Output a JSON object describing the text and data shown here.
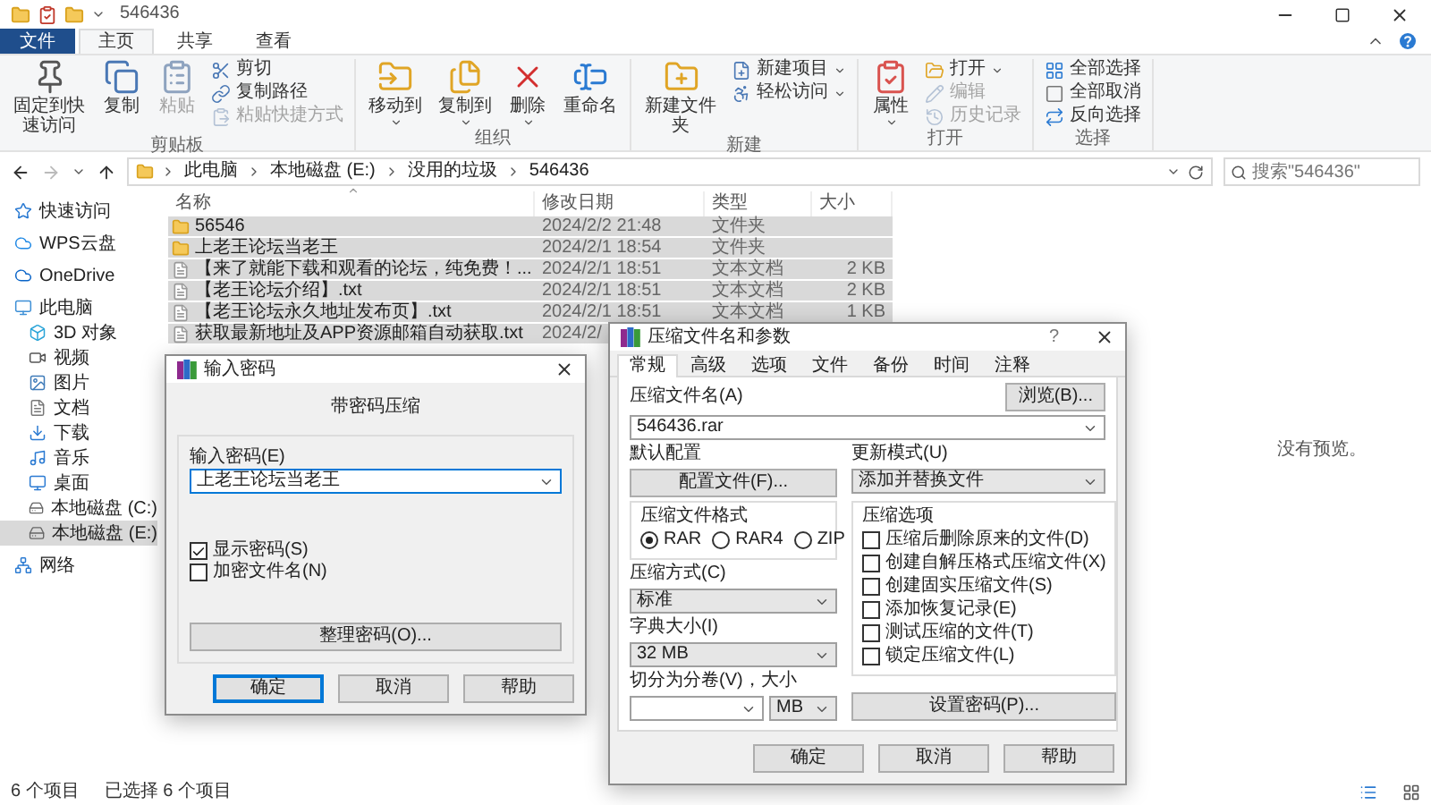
{
  "window": {
    "title": "546436"
  },
  "ribbon_tabs": [
    {
      "label": "文件",
      "kind": "file",
      "selected": false
    },
    {
      "label": "主页",
      "kind": "tab",
      "selected": true
    },
    {
      "label": "共享",
      "kind": "tab",
      "selected": false
    },
    {
      "label": "查看",
      "kind": "tab",
      "selected": false
    }
  ],
  "ribbon_groups": [
    {
      "label": "剪贴板",
      "items": [
        {
          "label": "固定到快速访问",
          "kind": "large",
          "disabled": false,
          "dropdown": false
        },
        {
          "label": "复制",
          "kind": "large",
          "disabled": false,
          "dropdown": false
        },
        {
          "label": "粘贴",
          "kind": "large",
          "disabled": true,
          "dropdown": false
        },
        {
          "label": "剪切",
          "kind": "small",
          "disabled": false,
          "dropdown": false
        },
        {
          "label": "复制路径",
          "kind": "small",
          "disabled": false,
          "dropdown": false
        },
        {
          "label": "粘贴快捷方式",
          "kind": "small",
          "disabled": true,
          "dropdown": false
        }
      ]
    },
    {
      "label": "组织",
      "items": [
        {
          "label": "移动到",
          "kind": "large",
          "disabled": false,
          "dropdown": true
        },
        {
          "label": "复制到",
          "kind": "large",
          "disabled": false,
          "dropdown": true
        },
        {
          "label": "删除",
          "kind": "large",
          "disabled": false,
          "dropdown": true
        },
        {
          "label": "重命名",
          "kind": "large",
          "disabled": false,
          "dropdown": false
        }
      ]
    },
    {
      "label": "新建",
      "items": [
        {
          "label": "新建文件夹",
          "kind": "large",
          "disabled": false,
          "dropdown": false
        },
        {
          "label": "新建项目",
          "kind": "small",
          "disabled": false,
          "dropdown": true
        },
        {
          "label": "轻松访问",
          "kind": "small",
          "disabled": false,
          "dropdown": true
        }
      ]
    },
    {
      "label": "打开",
      "items": [
        {
          "label": "属性",
          "kind": "large",
          "disabled": false,
          "dropdown": true
        },
        {
          "label": "打开",
          "kind": "small",
          "disabled": false,
          "dropdown": true
        },
        {
          "label": "编辑",
          "kind": "small",
          "disabled": true,
          "dropdown": false
        },
        {
          "label": "历史记录",
          "kind": "small",
          "disabled": true,
          "dropdown": false
        }
      ]
    },
    {
      "label": "选择",
      "items": [
        {
          "label": "全部选择",
          "kind": "small",
          "disabled": false,
          "dropdown": false
        },
        {
          "label": "全部取消",
          "kind": "small",
          "disabled": false,
          "dropdown": false
        },
        {
          "label": "反向选择",
          "kind": "small",
          "disabled": false,
          "dropdown": false
        }
      ]
    }
  ],
  "address": {
    "crumbs": [
      "此电脑",
      "本地磁盘 (E:)",
      "没用的垃圾",
      "546436"
    ]
  },
  "search": {
    "placeholder": "搜索\"546436\""
  },
  "nav": [
    {
      "label": "快速访问",
      "kind": "star",
      "selected": false
    },
    {
      "label": "WPS云盘",
      "kind": "cloud",
      "selected": false
    },
    {
      "label": "OneDrive",
      "kind": "onedrive",
      "selected": false
    },
    {
      "label": "此电脑",
      "kind": "pc",
      "selected": false,
      "children": [
        {
          "label": "3D 对象",
          "kind": "cube",
          "selected": false
        },
        {
          "label": "视频",
          "kind": "video",
          "selected": false
        },
        {
          "label": "图片",
          "kind": "image",
          "selected": false
        },
        {
          "label": "文档",
          "kind": "doc",
          "selected": false
        },
        {
          "label": "下载",
          "kind": "download",
          "selected": false
        },
        {
          "label": "音乐",
          "kind": "music",
          "selected": false
        },
        {
          "label": "桌面",
          "kind": "desktop",
          "selected": false
        },
        {
          "label": "本地磁盘 (C:)",
          "kind": "drive",
          "selected": false
        },
        {
          "label": "本地磁盘 (E:)",
          "kind": "drive",
          "selected": true
        }
      ]
    },
    {
      "label": "网络",
      "kind": "network",
      "selected": false
    }
  ],
  "files": {
    "columns": [
      "名称",
      "修改日期",
      "类型",
      "大小"
    ],
    "rows": [
      {
        "kind": "folder",
        "name": "56546",
        "date": "2024/2/2 21:48",
        "type": "文件夹",
        "selected": true
      },
      {
        "kind": "folder",
        "name": "上老王论坛当老王",
        "date": "2024/2/1 18:54",
        "type": "文件夹",
        "selected": true
      },
      {
        "kind": "text",
        "name": "【来了就能下载和观看的论坛，纯免费！...",
        "date": "2024/2/1 18:51",
        "type": "文本文档",
        "size": "2 KB",
        "selected": true
      },
      {
        "kind": "text",
        "name": "【老王论坛介绍】.txt",
        "date": "2024/2/1 18:51",
        "type": "文本文档",
        "size": "2 KB",
        "selected": true
      },
      {
        "kind": "text",
        "name": "【老王论坛永久地址发布页】.txt",
        "date": "2024/2/1 18:51",
        "type": "文本文档",
        "size": "1 KB",
        "selected": true
      },
      {
        "kind": "text",
        "name": "获取最新地址及APP资源邮箱自动获取.txt",
        "date": "2024/2/",
        "selected": true
      }
    ]
  },
  "preview": {
    "message": "没有预览。"
  },
  "status_bar": {
    "item_count": "6 个项目",
    "selection": "已选择 6 个项目"
  },
  "password_dialog": {
    "title": "输入密码",
    "heading": "带密码压缩",
    "field_label": "输入密码(E)",
    "password": "上老王论坛当老王",
    "options": [
      {
        "label": "显示密码(S)",
        "checked": true
      },
      {
        "label": "加密文件名(N)",
        "checked": false
      }
    ],
    "organize_button": "整理密码(O)...",
    "buttons": [
      {
        "label": "确定",
        "default": true
      },
      {
        "label": "取消",
        "default": false
      },
      {
        "label": "帮助",
        "default": false
      }
    ]
  },
  "archive_dialog": {
    "title": "压缩文件名和参数",
    "help_label": "?",
    "tabs": [
      {
        "label": "常规",
        "selected": true
      },
      {
        "label": "高级",
        "selected": false
      },
      {
        "label": "选项",
        "selected": false
      },
      {
        "label": "文件",
        "selected": false
      },
      {
        "label": "备份",
        "selected": false
      },
      {
        "label": "时间",
        "selected": false
      },
      {
        "label": "注释",
        "selected": false
      }
    ],
    "archive_name_label": "压缩文件名(A)",
    "browse_button": "浏览(B)...",
    "archive_name": "546436.rar",
    "profile_label": "默认配置",
    "profile_button": "配置文件(F)...",
    "update_mode_label": "更新模式(U)",
    "update_mode": "添加并替换文件",
    "format_group": {
      "title": "压缩文件格式",
      "options": [
        {
          "label": "RAR",
          "selected": true
        },
        {
          "label": "RAR4",
          "selected": false
        },
        {
          "label": "ZIP",
          "selected": false
        }
      ]
    },
    "method_label": "压缩方式(C)",
    "method": "标准",
    "dictionary_label": "字典大小(I)",
    "dictionary": "32 MB",
    "split_label": "切分为分卷(V)，大小",
    "split_unit": "MB",
    "options_group": {
      "title": "压缩选项",
      "options": [
        {
          "label": "压缩后删除原来的文件(D)",
          "checked": false
        },
        {
          "label": "创建自解压格式压缩文件(X)",
          "checked": false
        },
        {
          "label": "创建固实压缩文件(S)",
          "checked": false
        },
        {
          "label": "添加恢复记录(E)",
          "checked": false
        },
        {
          "label": "测试压缩的文件(T)",
          "checked": false
        },
        {
          "label": "锁定压缩文件(L)",
          "checked": false
        }
      ]
    },
    "password_button": "设置密码(P)...",
    "buttons": [
      {
        "label": "确定",
        "default": false
      },
      {
        "label": "取消",
        "default": false
      },
      {
        "label": "帮助",
        "default": false
      }
    ]
  }
}
